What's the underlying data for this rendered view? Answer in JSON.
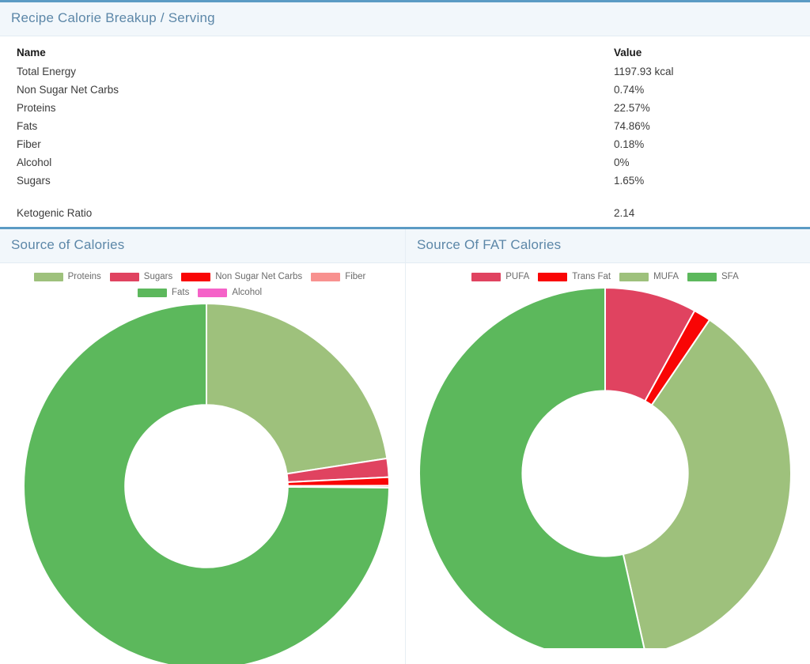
{
  "breakup_panel": {
    "title": "Recipe Calorie Breakup / Serving",
    "columns": [
      "Name",
      "Value"
    ],
    "rows": [
      {
        "name": "Total Energy",
        "value": "1197.93 kcal"
      },
      {
        "name": "Non Sugar Net Carbs",
        "value": "0.74%"
      },
      {
        "name": "Proteins",
        "value": "22.57%"
      },
      {
        "name": "Fats",
        "value": "74.86%"
      },
      {
        "name": "Fiber",
        "value": "0.18%"
      },
      {
        "name": "Alcohol",
        "value": "0%"
      },
      {
        "name": "Sugars",
        "value": "1.65%"
      }
    ],
    "footer_row": {
      "name": "Ketogenic Ratio",
      "value": "2.14"
    }
  },
  "source_of_calories": {
    "title": "Source of Calories"
  },
  "source_of_fat_calories": {
    "title": "Source Of FAT Calories"
  },
  "theme": {
    "accent": "#5b9bc4",
    "header_bg": "#f2f7fb",
    "title_color": "#5c87a8"
  },
  "chart_data": [
    {
      "type": "pie",
      "variant": "donut",
      "title": "Source of Calories",
      "legend_position": "top",
      "start_angle_deg": 0,
      "direction": "clockwise",
      "inner_radius_ratio": 0.445,
      "categories": [
        "Proteins",
        "Sugars",
        "Non Sugar Net Carbs",
        "Fiber",
        "Fats",
        "Alcohol"
      ],
      "values": [
        22.57,
        1.65,
        0.74,
        0.18,
        74.86,
        0
      ],
      "unit": "%",
      "colors": [
        "#9ec17c",
        "#e04360",
        "#f90505",
        "#f8918f",
        "#5cb85c",
        "#f562c8"
      ]
    },
    {
      "type": "pie",
      "variant": "donut",
      "title": "Source Of FAT Calories",
      "legend_position": "top",
      "start_angle_deg": 0,
      "direction": "clockwise",
      "inner_radius_ratio": 0.445,
      "categories": [
        "PUFA",
        "Trans Fat",
        "MUFA",
        "SFA"
      ],
      "values": [
        8.0,
        1.5,
        37.0,
        53.5
      ],
      "unit": "%",
      "colors": [
        "#e04360",
        "#f90505",
        "#9ec17c",
        "#5cb85c"
      ]
    }
  ]
}
